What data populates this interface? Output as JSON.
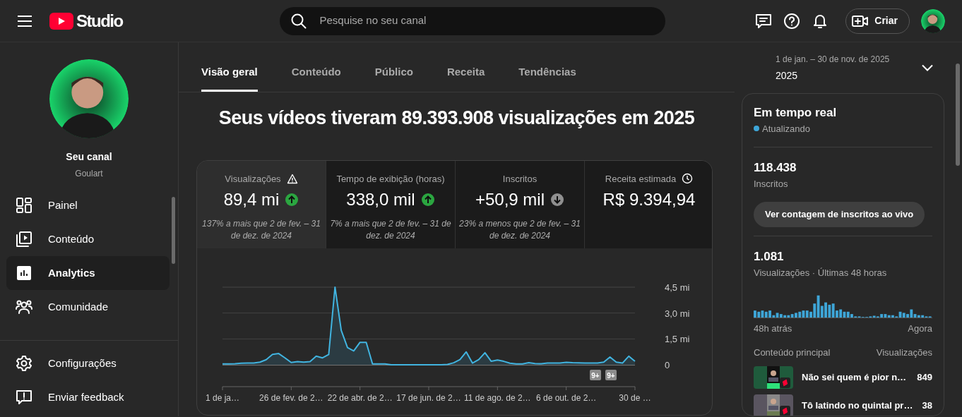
{
  "header": {
    "logo": "Studio",
    "search": {
      "placeholder": "Pesquise no seu canal"
    },
    "create_button": "Criar"
  },
  "sidebar": {
    "channel": {
      "title": "Seu canal",
      "name": "Goulart"
    },
    "items": [
      {
        "label": "Painel",
        "kind": "dashboard",
        "selected": false
      },
      {
        "label": "Conteúdo",
        "kind": "content",
        "selected": false
      },
      {
        "label": "Analytics",
        "kind": "analytics",
        "selected": true
      },
      {
        "label": "Comunidade",
        "kind": "community",
        "selected": false
      }
    ],
    "footer_items": [
      {
        "label": "Configurações",
        "kind": "settings"
      },
      {
        "label": "Enviar feedback",
        "kind": "feedback"
      }
    ]
  },
  "tabs": [
    {
      "label": "Visão geral",
      "selected": true
    },
    {
      "label": "Conteúdo",
      "selected": false
    },
    {
      "label": "Público",
      "selected": false
    },
    {
      "label": "Receita",
      "selected": false
    },
    {
      "label": "Tendências",
      "selected": false
    }
  ],
  "date_range": {
    "range": "1 de jan. – 30 de nov. de 2025",
    "label": "2025"
  },
  "headline": "Seus vídeos tiveram 89.393.908 visualizações em 2025",
  "metrics": [
    {
      "label": "Visualizações",
      "warning": true,
      "delayed": false,
      "value": "89,4 mi",
      "increased": true,
      "comparison": "137% a mais que 2 de fev. – 31 de dez. de 2024",
      "selected": true
    },
    {
      "label": "Tempo de exibição (horas)",
      "warning": false,
      "delayed": false,
      "value": "338,0 mil",
      "increased": true,
      "comparison": "7% a mais que 2 de fev. – 31 de dez. de 2024",
      "selected": false
    },
    {
      "label": "Inscritos",
      "warning": false,
      "delayed": false,
      "value": "+50,9 mil",
      "increased": false,
      "comparison": "23% a menos que 2 de fev. – 31 de dez. de 2024",
      "selected": false
    },
    {
      "label": "Receita estimada",
      "warning": false,
      "delayed": true,
      "value": "R$ 9.394,94",
      "selected": false
    }
  ],
  "chart_data": {
    "type": "line",
    "categories": [
      "1 de ja…",
      null,
      null,
      null,
      null,
      null,
      null,
      null,
      null,
      null,
      null,
      "26 de fev. de 2…",
      null,
      null,
      null,
      null,
      null,
      null,
      null,
      null,
      null,
      null,
      "22 de abr. de 2…",
      null,
      null,
      null,
      null,
      null,
      null,
      null,
      null,
      null,
      null,
      "17 de jun. de 2…",
      null,
      null,
      null,
      null,
      null,
      null,
      null,
      null,
      null,
      null,
      "11 de ago. de 2…",
      null,
      null,
      null,
      null,
      null,
      null,
      null,
      null,
      null,
      null,
      "6 de out. de 2…",
      null,
      null,
      null,
      null,
      null,
      null,
      null,
      null,
      null,
      null,
      "30 de …"
    ],
    "series": [
      {
        "color": "#41b4e0",
        "values": [
          0.05,
          0.05,
          0.06,
          0.09,
          0.1,
          0.1,
          0.15,
          0.3,
          0.6,
          0.65,
          0.4,
          0.13,
          0.19,
          0.15,
          0.18,
          0.5,
          0.4,
          0.6,
          4.5,
          2.0,
          1.0,
          0.8,
          1.3,
          1.3,
          0.05,
          0.05,
          0.05,
          0,
          0,
          0,
          0,
          0,
          0,
          0,
          0,
          0,
          0.02,
          0.12,
          0.3,
          0.75,
          0.1,
          0.3,
          0.7,
          0.2,
          0.28,
          0.2,
          0.09,
          0.05,
          0.05,
          0.12,
          0.07,
          0.06,
          0.1,
          0.1,
          0.1,
          0.14,
          0.12,
          0.11,
          0.1,
          0.1,
          0.1,
          0.15,
          0.45,
          0.15,
          0.1,
          0.5,
          0.2
        ]
      }
    ],
    "ylim": [
      0,
      4.5
    ],
    "yticks": [
      {
        "value": 0,
        "label": "0"
      },
      {
        "value": 1.5,
        "label": "1,5 mi"
      },
      {
        "value": 3,
        "label": "3,0 mi"
      },
      {
        "value": 4.5,
        "label": "4,5 mi"
      }
    ],
    "annotations": [
      "9+",
      "9+"
    ]
  },
  "realtime": {
    "title": "Em tempo real",
    "status": "Atualizando",
    "subscribers": "118.438",
    "subscribers_label": "Inscritos",
    "live_button": "Ver contagem de inscritos ao vivo",
    "views": "1.081",
    "views_label": "Visualizações · Últimas 48 horas",
    "axis_start": "48h atrás",
    "axis_end": "Agora",
    "top_content_header": "Conteúdo principal",
    "top_content_views_header": "Visualizações",
    "top_content": [
      {
        "title": "Não sei quem é pior n…",
        "views": "849"
      },
      {
        "title": "Tô latindo no quintal pr…",
        "views": "38"
      }
    ]
  }
}
